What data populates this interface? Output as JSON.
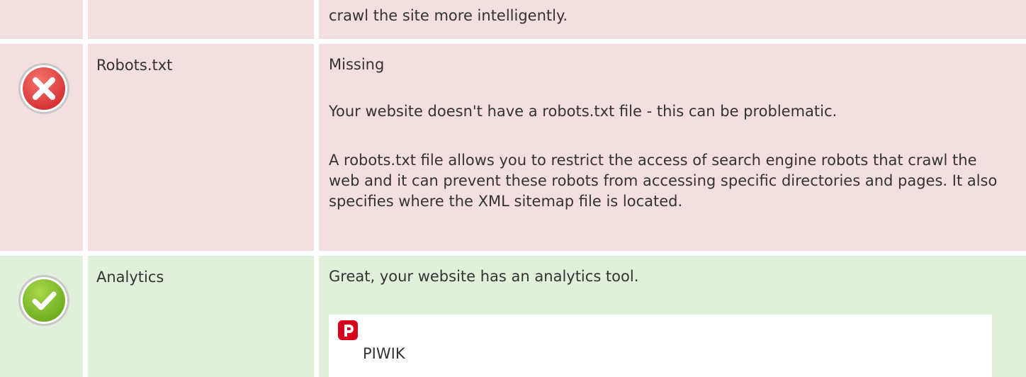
{
  "rows": [
    {
      "status": "error",
      "name": "",
      "body": [
        "crawl the site more intelligently."
      ]
    },
    {
      "status": "error",
      "name": "Robots.txt",
      "body": [
        "Missing",
        "Your website doesn't have a robots.txt file - this can be problematic.",
        "A robots.txt file allows you to restrict the access of search engine robots that crawl the web and it can prevent these robots from accessing specific directories and pages. It also specifies where the XML sitemap file is located."
      ]
    },
    {
      "status": "success",
      "name": "Analytics",
      "body": [
        "Great, your website has an analytics tool."
      ],
      "tools": [
        {
          "name": "PIWIK",
          "icon": "piwik-logo-icon"
        }
      ]
    }
  ],
  "colors": {
    "error_row_bg": "#f3dfe0",
    "success_row_bg": "#e0f0db",
    "error_icon": "#e0393c",
    "success_icon": "#7dbb2c",
    "piwik_logo": "#d6001c"
  },
  "icons": {
    "error": "error-x-icon",
    "success": "success-check-icon"
  }
}
